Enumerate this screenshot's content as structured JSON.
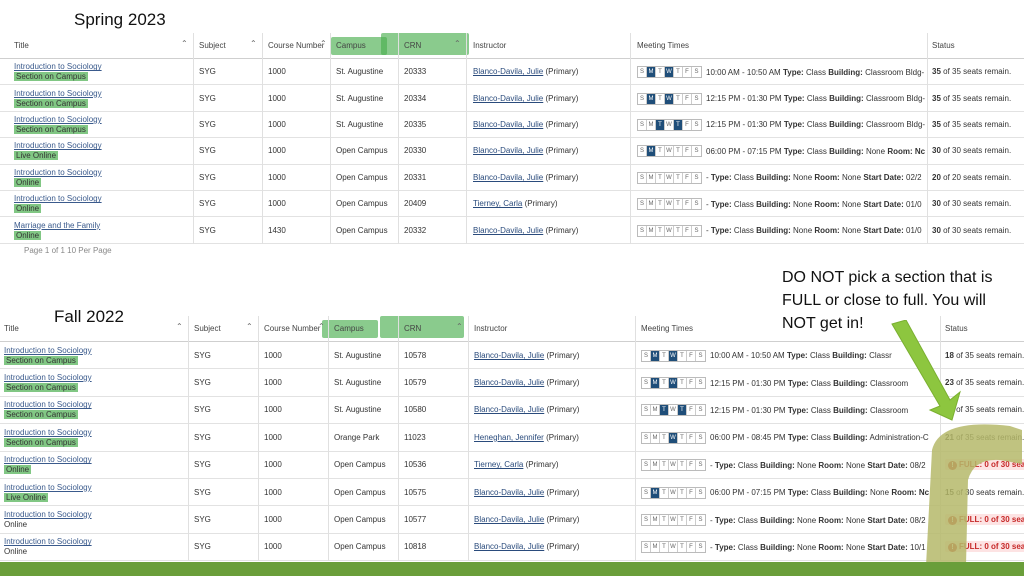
{
  "spring": {
    "heading": "Spring 2023",
    "columns": {
      "title": "Title",
      "subject": "Subject",
      "course_number": "Course Number",
      "campus": "Campus",
      "crn": "CRN",
      "instructor": "Instructor",
      "meeting_times": "Meeting Times",
      "status": "Status"
    },
    "rows": [
      {
        "title": "Introduction to Sociology",
        "sub": "Section on Campus",
        "subject": "SYG",
        "number": "1000",
        "campus": "St. Augustine",
        "crn": "20333",
        "instructor": "Blanco-Davila, Julie",
        "role": "(Primary)",
        "days": [
          0,
          1,
          0,
          1,
          0,
          0,
          0
        ],
        "time": "10:00 AM - 10:50 AM",
        "building": "Classroom Bldg-",
        "seats": "35",
        "seats_rest": "of 35 seats remain."
      },
      {
        "title": "Introduction to Sociology",
        "sub": "Section on Campus",
        "subject": "SYG",
        "number": "1000",
        "campus": "St. Augustine",
        "crn": "20334",
        "instructor": "Blanco-Davila, Julie",
        "role": "(Primary)",
        "days": [
          0,
          1,
          0,
          1,
          0,
          0,
          0
        ],
        "time": "12:15 PM - 01:30 PM",
        "building": "Classroom Bldg-",
        "seats": "35",
        "seats_rest": "of 35 seats remain."
      },
      {
        "title": "Introduction to Sociology",
        "sub": "Section on Campus",
        "subject": "SYG",
        "number": "1000",
        "campus": "St. Augustine",
        "crn": "20335",
        "instructor": "Blanco-Davila, Julie",
        "role": "(Primary)",
        "days": [
          0,
          0,
          1,
          0,
          1,
          0,
          0
        ],
        "time": "12:15 PM - 01:30 PM",
        "building": "Classroom Bldg-",
        "seats": "35",
        "seats_rest": "of 35 seats remain."
      },
      {
        "title": "Introduction to Sociology",
        "sub": "Live Online",
        "subject": "SYG",
        "number": "1000",
        "campus": "Open Campus",
        "crn": "20330",
        "instructor": "Blanco-Davila, Julie",
        "role": "(Primary)",
        "days": [
          0,
          1,
          0,
          0,
          0,
          0,
          0
        ],
        "time": "06:00 PM - 07:15 PM",
        "building": "None",
        "room": "Room: Nc",
        "seats": "30",
        "seats_rest": "of 30 seats remain."
      },
      {
        "title": "Introduction to Sociology",
        "sub": "Online",
        "subject": "SYG",
        "number": "1000",
        "campus": "Open Campus",
        "crn": "20331",
        "instructor": "Blanco-Davila, Julie",
        "role": "(Primary)",
        "days": [
          0,
          0,
          0,
          0,
          0,
          0,
          0
        ],
        "time": "-",
        "building": "None",
        "room": "Room:",
        "room_val": "None",
        "start": "Start Date:",
        "start_val": "02/2",
        "seats": "20",
        "seats_rest": "of 20 seats remain."
      },
      {
        "title": "Introduction to Sociology",
        "sub": "Online",
        "subject": "SYG",
        "number": "1000",
        "campus": "Open Campus",
        "crn": "20409",
        "instructor": "Tierney, Carla",
        "role": "(Primary)",
        "days": [
          0,
          0,
          0,
          0,
          0,
          0,
          0
        ],
        "time": "-",
        "building": "None",
        "room": "Room:",
        "room_val": "None",
        "start": "Start Date:",
        "start_val": "01/0",
        "seats": "30",
        "seats_rest": "of 30 seats remain."
      },
      {
        "title": "Marriage and the Family",
        "sub": "Online",
        "subject": "SYG",
        "number": "1430",
        "campus": "Open Campus",
        "crn": "20332",
        "instructor": "Blanco-Davila, Julie",
        "role": "(Primary)",
        "days": [
          0,
          0,
          0,
          0,
          0,
          0,
          0
        ],
        "time": "-",
        "building": "None",
        "room": "Room:",
        "room_val": "None",
        "start": "Start Date:",
        "start_val": "01/0",
        "seats": "30",
        "seats_rest": "of 30 seats remain."
      }
    ],
    "pager": "Page  1  of  1      10  Per Page"
  },
  "fall": {
    "heading": "Fall  2022",
    "columns": {
      "title": "Title",
      "subject": "Subject",
      "course_number": "Course Number",
      "campus": "Campus",
      "crn": "CRN",
      "instructor": "Instructor",
      "meeting_times": "Meeting Times",
      "status": "Status"
    },
    "rows": [
      {
        "title": "Introduction to Sociology",
        "sub": "Section on Campus",
        "subject": "SYG",
        "number": "1000",
        "campus": "St. Augustine",
        "crn": "10578",
        "instructor": "Blanco-Davila, Julie",
        "role": "(Primary)",
        "days": [
          0,
          1,
          0,
          1,
          0,
          0,
          0
        ],
        "time": "10:00 AM - 10:50 AM",
        "building": "Classr",
        "seats": "18",
        "seats_rest": "of 35 seats remain."
      },
      {
        "title": "Introduction to Sociology",
        "sub": "Section on Campus",
        "subject": "SYG",
        "number": "1000",
        "campus": "St. Augustine",
        "crn": "10579",
        "instructor": "Blanco-Davila, Julie",
        "role": "(Primary)",
        "days": [
          0,
          1,
          0,
          1,
          0,
          0,
          0
        ],
        "time": "12:15 PM - 01:30 PM",
        "building": "Classroom",
        "seats": "23",
        "seats_rest": "of 35 seats remain."
      },
      {
        "title": "Introduction to Sociology",
        "sub": "Section on Campus",
        "subject": "SYG",
        "number": "1000",
        "campus": "St. Augustine",
        "crn": "10580",
        "instructor": "Blanco-Davila, Julie",
        "role": "(Primary)",
        "days": [
          0,
          0,
          1,
          0,
          1,
          0,
          0
        ],
        "time": "12:15 PM - 01:30 PM",
        "building": "Classroom",
        "seats": "22",
        "seats_rest": "of 35 seats remain."
      },
      {
        "title": "Introduction to Sociology",
        "sub": "Section on Campus",
        "subject": "SYG",
        "number": "1000",
        "campus": "Orange Park",
        "crn": "11023",
        "instructor": "Heneghan, Jennifer",
        "role": "(Primary)",
        "days": [
          0,
          0,
          0,
          1,
          0,
          0,
          0
        ],
        "time": "06:00 PM - 08:45 PM",
        "building": "Administration-C",
        "seats": "21",
        "seats_rest": "of 35 seats remain."
      },
      {
        "title": "Introduction to Sociology",
        "sub": "Online",
        "subject": "SYG",
        "number": "1000",
        "campus": "Open Campus",
        "crn": "10536",
        "instructor": "Tierney, Carla",
        "role": "(Primary)",
        "days": [
          0,
          0,
          0,
          0,
          0,
          0,
          0
        ],
        "time": "-",
        "building": "None",
        "room": "Room:",
        "room_val": "None",
        "start": "Start Date:",
        "start_val": "08/2",
        "full": "FULL: 0 of 30 sea"
      },
      {
        "title": "Introduction to Sociology",
        "sub": "Live Online",
        "subject": "SYG",
        "number": "1000",
        "campus": "Open Campus",
        "crn": "10575",
        "instructor": "Blanco-Davila, Julie",
        "role": "(Primary)",
        "days": [
          0,
          1,
          0,
          0,
          0,
          0,
          0
        ],
        "time": "06:00 PM - 07:15 PM",
        "building": "None",
        "room": "Room: Nc",
        "seats": "15",
        "seats_rest": "of 30 seats remain."
      },
      {
        "title": "Introduction to Sociology",
        "sub": "Online",
        "subject": "SYG",
        "number": "1000",
        "campus": "Open Campus",
        "crn": "10577",
        "instructor": "Blanco-Davila, Julie",
        "role": "(Primary)",
        "days": [
          0,
          0,
          0,
          0,
          0,
          0,
          0
        ],
        "time": "-",
        "building": "None",
        "room": "Room:",
        "room_val": "None",
        "start": "Start Date:",
        "start_val": "08/2",
        "full": "FULL: 0 of 30 sea"
      },
      {
        "title": "Introduction to Sociology",
        "sub": "Online",
        "subject": "SYG",
        "number": "1000",
        "campus": "Open Campus",
        "crn": "10818",
        "instructor": "Blanco-Davila, Julie",
        "role": "(Primary)",
        "days": [
          0,
          0,
          0,
          0,
          0,
          0,
          0
        ],
        "time": "-",
        "building": "None",
        "room": "Room:",
        "room_val": "None",
        "start": "Start Date:",
        "start_val": "10/1",
        "full": "FULL: 0 of 30 sea"
      }
    ]
  },
  "labels": {
    "day_letters": [
      "S",
      "M",
      "T",
      "W",
      "T",
      "F",
      "S"
    ],
    "type": "Type:",
    "type_val": "Class",
    "building": "Building:",
    "room": "Room:"
  },
  "callout": "DO NOT pick a section that is FULL or close to full.  You will NOT get in!",
  "colors": {
    "highlight": "#4caf50",
    "arrow": "#8dc63f",
    "bracket": "#b5b86a",
    "bar": "#6a9e3a",
    "full": "#c62828"
  }
}
